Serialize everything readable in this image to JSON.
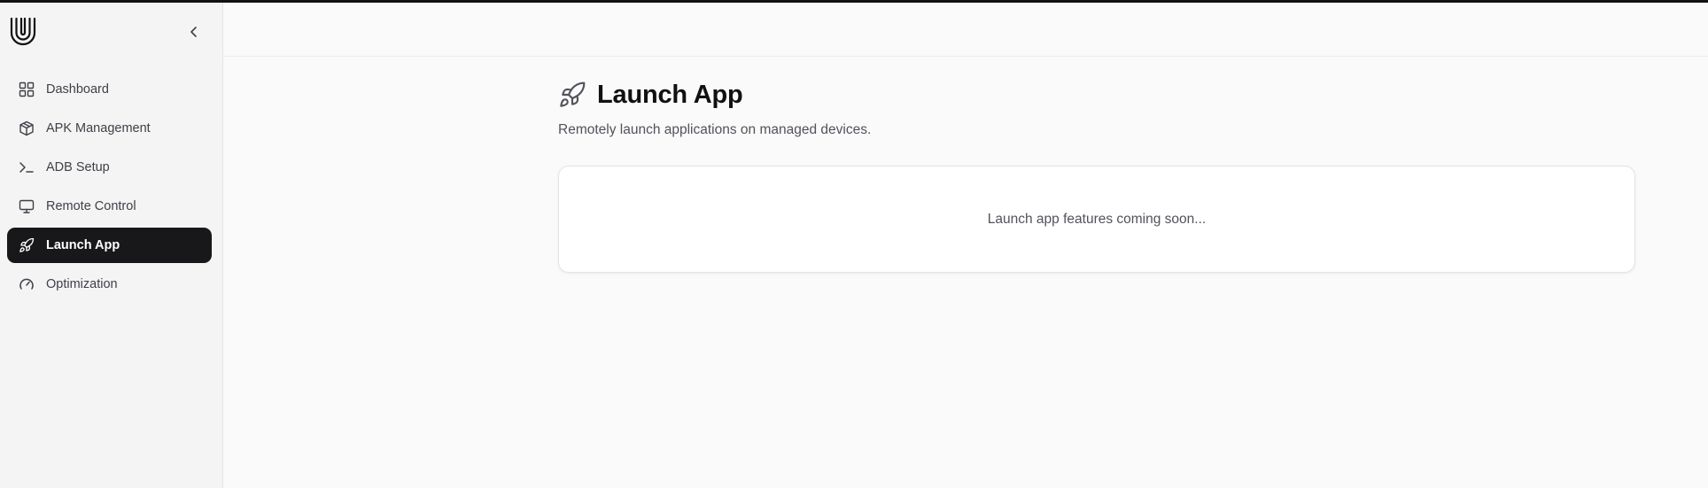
{
  "nav": {
    "items": [
      {
        "label": "Dashboard",
        "icon": "grid-icon"
      },
      {
        "label": "APK Management",
        "icon": "package-icon"
      },
      {
        "label": "ADB Setup",
        "icon": "terminal-icon"
      },
      {
        "label": "Remote Control",
        "icon": "monitor-icon"
      },
      {
        "label": "Launch App",
        "icon": "rocket-icon",
        "active": true
      },
      {
        "label": "Optimization",
        "icon": "gauge-icon"
      }
    ]
  },
  "page": {
    "title": "Launch App",
    "subtitle": "Remotely launch applications on managed devices.",
    "placeholder": "Launch app features coming soon..."
  },
  "colors": {
    "active_bg": "#18181b",
    "text": "#111111",
    "muted": "#52525b"
  }
}
